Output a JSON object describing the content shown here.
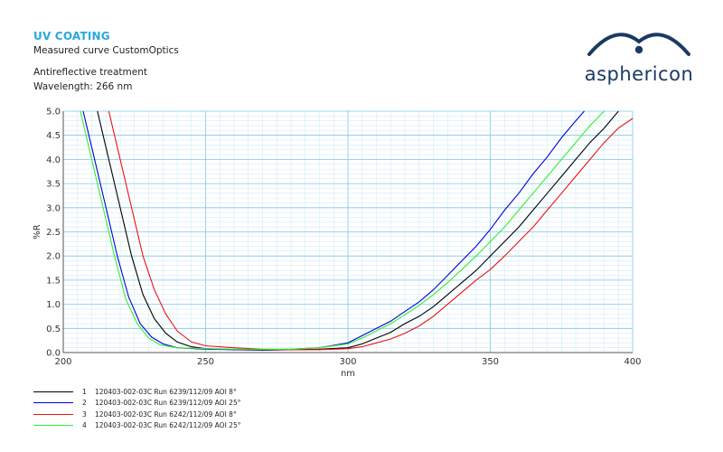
{
  "header": {
    "title": "UV COATING",
    "subtitle": "Measured curve CustomOptics",
    "line1": "Antireflective treatment",
    "line2": "Wavelength: 266 nm"
  },
  "logo": {
    "text": "asphericon"
  },
  "chart_data": {
    "type": "line",
    "xlabel": "nm",
    "ylabel": "%R",
    "xlim": [
      200,
      400
    ],
    "ylim": [
      0,
      5
    ],
    "x_ticks": [
      200,
      250,
      300,
      350,
      400
    ],
    "y_ticks": [
      "0.0",
      "0.5",
      "1.0",
      "1.5",
      "2.0",
      "2.5",
      "3.0",
      "3.5",
      "4.0",
      "4.5",
      "5.0"
    ],
    "grid": true,
    "legend_position": "bottom-left",
    "series": [
      {
        "num": "1",
        "name": "120403-002-03C Run 6239/112/09 AOI 8°",
        "color": "#000000",
        "points": [
          [
            212,
            5.0
          ],
          [
            216,
            4.0
          ],
          [
            220,
            3.0
          ],
          [
            224,
            2.0
          ],
          [
            228,
            1.2
          ],
          [
            232,
            0.7
          ],
          [
            236,
            0.4
          ],
          [
            240,
            0.22
          ],
          [
            245,
            0.12
          ],
          [
            250,
            0.08
          ],
          [
            260,
            0.06
          ],
          [
            270,
            0.05
          ],
          [
            280,
            0.06
          ],
          [
            290,
            0.07
          ],
          [
            300,
            0.1
          ],
          [
            305,
            0.18
          ],
          [
            310,
            0.3
          ],
          [
            315,
            0.42
          ],
          [
            320,
            0.6
          ],
          [
            325,
            0.75
          ],
          [
            330,
            0.95
          ],
          [
            335,
            1.2
          ],
          [
            340,
            1.45
          ],
          [
            345,
            1.7
          ],
          [
            350,
            2.0
          ],
          [
            355,
            2.3
          ],
          [
            360,
            2.6
          ],
          [
            365,
            2.95
          ],
          [
            370,
            3.3
          ],
          [
            375,
            3.65
          ],
          [
            380,
            4.0
          ],
          [
            385,
            4.35
          ],
          [
            390,
            4.65
          ],
          [
            395,
            5.0
          ]
        ]
      },
      {
        "num": "2",
        "name": "120403-002-03C Run 6239/112/09 AOI 25°",
        "color": "#0000dd",
        "points": [
          [
            207,
            5.0
          ],
          [
            211,
            4.0
          ],
          [
            215,
            3.0
          ],
          [
            219,
            2.0
          ],
          [
            223,
            1.15
          ],
          [
            227,
            0.6
          ],
          [
            231,
            0.32
          ],
          [
            235,
            0.18
          ],
          [
            240,
            0.1
          ],
          [
            250,
            0.07
          ],
          [
            260,
            0.06
          ],
          [
            270,
            0.06
          ],
          [
            280,
            0.07
          ],
          [
            290,
            0.1
          ],
          [
            300,
            0.2
          ],
          [
            305,
            0.35
          ],
          [
            310,
            0.5
          ],
          [
            315,
            0.65
          ],
          [
            320,
            0.85
          ],
          [
            325,
            1.05
          ],
          [
            330,
            1.3
          ],
          [
            335,
            1.6
          ],
          [
            340,
            1.9
          ],
          [
            345,
            2.2
          ],
          [
            350,
            2.55
          ],
          [
            355,
            2.95
          ],
          [
            360,
            3.3
          ],
          [
            365,
            3.7
          ],
          [
            370,
            4.05
          ],
          [
            375,
            4.45
          ],
          [
            380,
            4.8
          ],
          [
            383,
            5.0
          ]
        ]
      },
      {
        "num": "3",
        "name": "120403-002-03C Run 6242/112/09 AOI 8°",
        "color": "#ee1111",
        "points": [
          [
            216,
            5.0
          ],
          [
            220,
            4.0
          ],
          [
            224,
            3.0
          ],
          [
            228,
            2.0
          ],
          [
            232,
            1.3
          ],
          [
            236,
            0.8
          ],
          [
            240,
            0.45
          ],
          [
            245,
            0.22
          ],
          [
            250,
            0.14
          ],
          [
            260,
            0.1
          ],
          [
            270,
            0.07
          ],
          [
            280,
            0.06
          ],
          [
            290,
            0.06
          ],
          [
            300,
            0.08
          ],
          [
            305,
            0.12
          ],
          [
            310,
            0.2
          ],
          [
            315,
            0.28
          ],
          [
            320,
            0.4
          ],
          [
            325,
            0.55
          ],
          [
            330,
            0.75
          ],
          [
            335,
            1.0
          ],
          [
            340,
            1.25
          ],
          [
            345,
            1.5
          ],
          [
            350,
            1.72
          ],
          [
            355,
            2.0
          ],
          [
            360,
            2.3
          ],
          [
            365,
            2.6
          ],
          [
            370,
            2.95
          ],
          [
            375,
            3.3
          ],
          [
            380,
            3.65
          ],
          [
            385,
            4.0
          ],
          [
            390,
            4.35
          ],
          [
            395,
            4.65
          ],
          [
            400,
            4.85
          ]
        ]
      },
      {
        "num": "4",
        "name": "120403-002-03C Run 6242/112/09 AOI 25°",
        "color": "#33ee33",
        "points": [
          [
            206,
            5.0
          ],
          [
            210,
            4.0
          ],
          [
            214,
            3.0
          ],
          [
            218,
            2.0
          ],
          [
            222,
            1.1
          ],
          [
            226,
            0.6
          ],
          [
            230,
            0.3
          ],
          [
            234,
            0.16
          ],
          [
            240,
            0.1
          ],
          [
            250,
            0.08
          ],
          [
            260,
            0.07
          ],
          [
            270,
            0.07
          ],
          [
            280,
            0.07
          ],
          [
            290,
            0.1
          ],
          [
            300,
            0.18
          ],
          [
            305,
            0.3
          ],
          [
            310,
            0.45
          ],
          [
            315,
            0.6
          ],
          [
            320,
            0.78
          ],
          [
            325,
            0.98
          ],
          [
            330,
            1.2
          ],
          [
            335,
            1.45
          ],
          [
            340,
            1.72
          ],
          [
            345,
            2.0
          ],
          [
            350,
            2.3
          ],
          [
            355,
            2.6
          ],
          [
            360,
            2.95
          ],
          [
            365,
            3.3
          ],
          [
            370,
            3.65
          ],
          [
            375,
            4.0
          ],
          [
            380,
            4.35
          ],
          [
            385,
            4.7
          ],
          [
            390,
            5.0
          ]
        ]
      }
    ]
  }
}
